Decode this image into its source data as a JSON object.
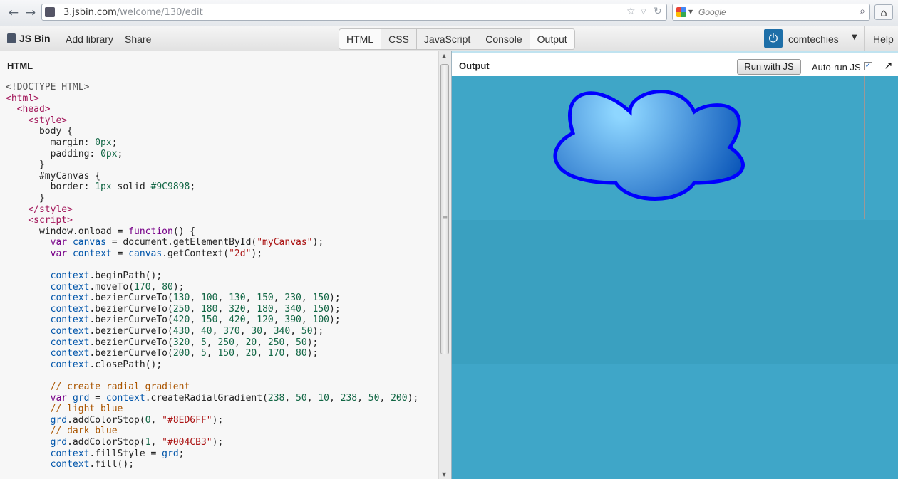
{
  "browser": {
    "url_host": "3.jsbin.com",
    "url_path": "/welcome/130/edit",
    "search_placeholder": "Google"
  },
  "toolbar": {
    "logo": "JS Bin",
    "add_library": "Add library",
    "share": "Share",
    "panels": [
      "HTML",
      "CSS",
      "JavaScript",
      "Console",
      "Output"
    ],
    "username": "comtechies",
    "help": "Help"
  },
  "html_panel": {
    "title": "HTML"
  },
  "output_panel": {
    "title": "Output",
    "run_button": "Run with JS",
    "autorun_label": "Auto-run JS",
    "autorun_checked": true,
    "background_color": "#3da5c6"
  },
  "canvas": {
    "border_color": "#9C9898",
    "gradient_light": "#8ED6FF",
    "gradient_dark": "#004CB3",
    "stroke_color": "#0000ff"
  },
  "code_lines": [
    "<!DOCTYPE HTML>",
    "<html>",
    "  <head>",
    "    <style>",
    "      body {",
    "        margin: 0px;",
    "        padding: 0px;",
    "      }",
    "      #myCanvas {",
    "        border: 1px solid #9C9898;",
    "      }",
    "    </style>",
    "    <script>",
    "      window.onload = function() {",
    "        var canvas = document.getElementById(\"myCanvas\");",
    "        var context = canvas.getContext(\"2d\");",
    "",
    "        context.beginPath();",
    "        context.moveTo(170, 80);",
    "        context.bezierCurveTo(130, 100, 130, 150, 230, 150);",
    "        context.bezierCurveTo(250, 180, 320, 180, 340, 150);",
    "        context.bezierCurveTo(420, 150, 420, 120, 390, 100);",
    "        context.bezierCurveTo(430, 40, 370, 30, 340, 50);",
    "        context.bezierCurveTo(320, 5, 250, 20, 250, 50);",
    "        context.bezierCurveTo(200, 5, 150, 20, 170, 80);",
    "        context.closePath();",
    "",
    "        // create radial gradient",
    "        var grd = context.createRadialGradient(238, 50, 10, 238, 50, 200);",
    "        // light blue",
    "        grd.addColorStop(0, \"#8ED6FF\");",
    "        // dark blue",
    "        grd.addColorStop(1, \"#004CB3\");",
    "        context.fillStyle = grd;",
    "        context.fill();"
  ]
}
